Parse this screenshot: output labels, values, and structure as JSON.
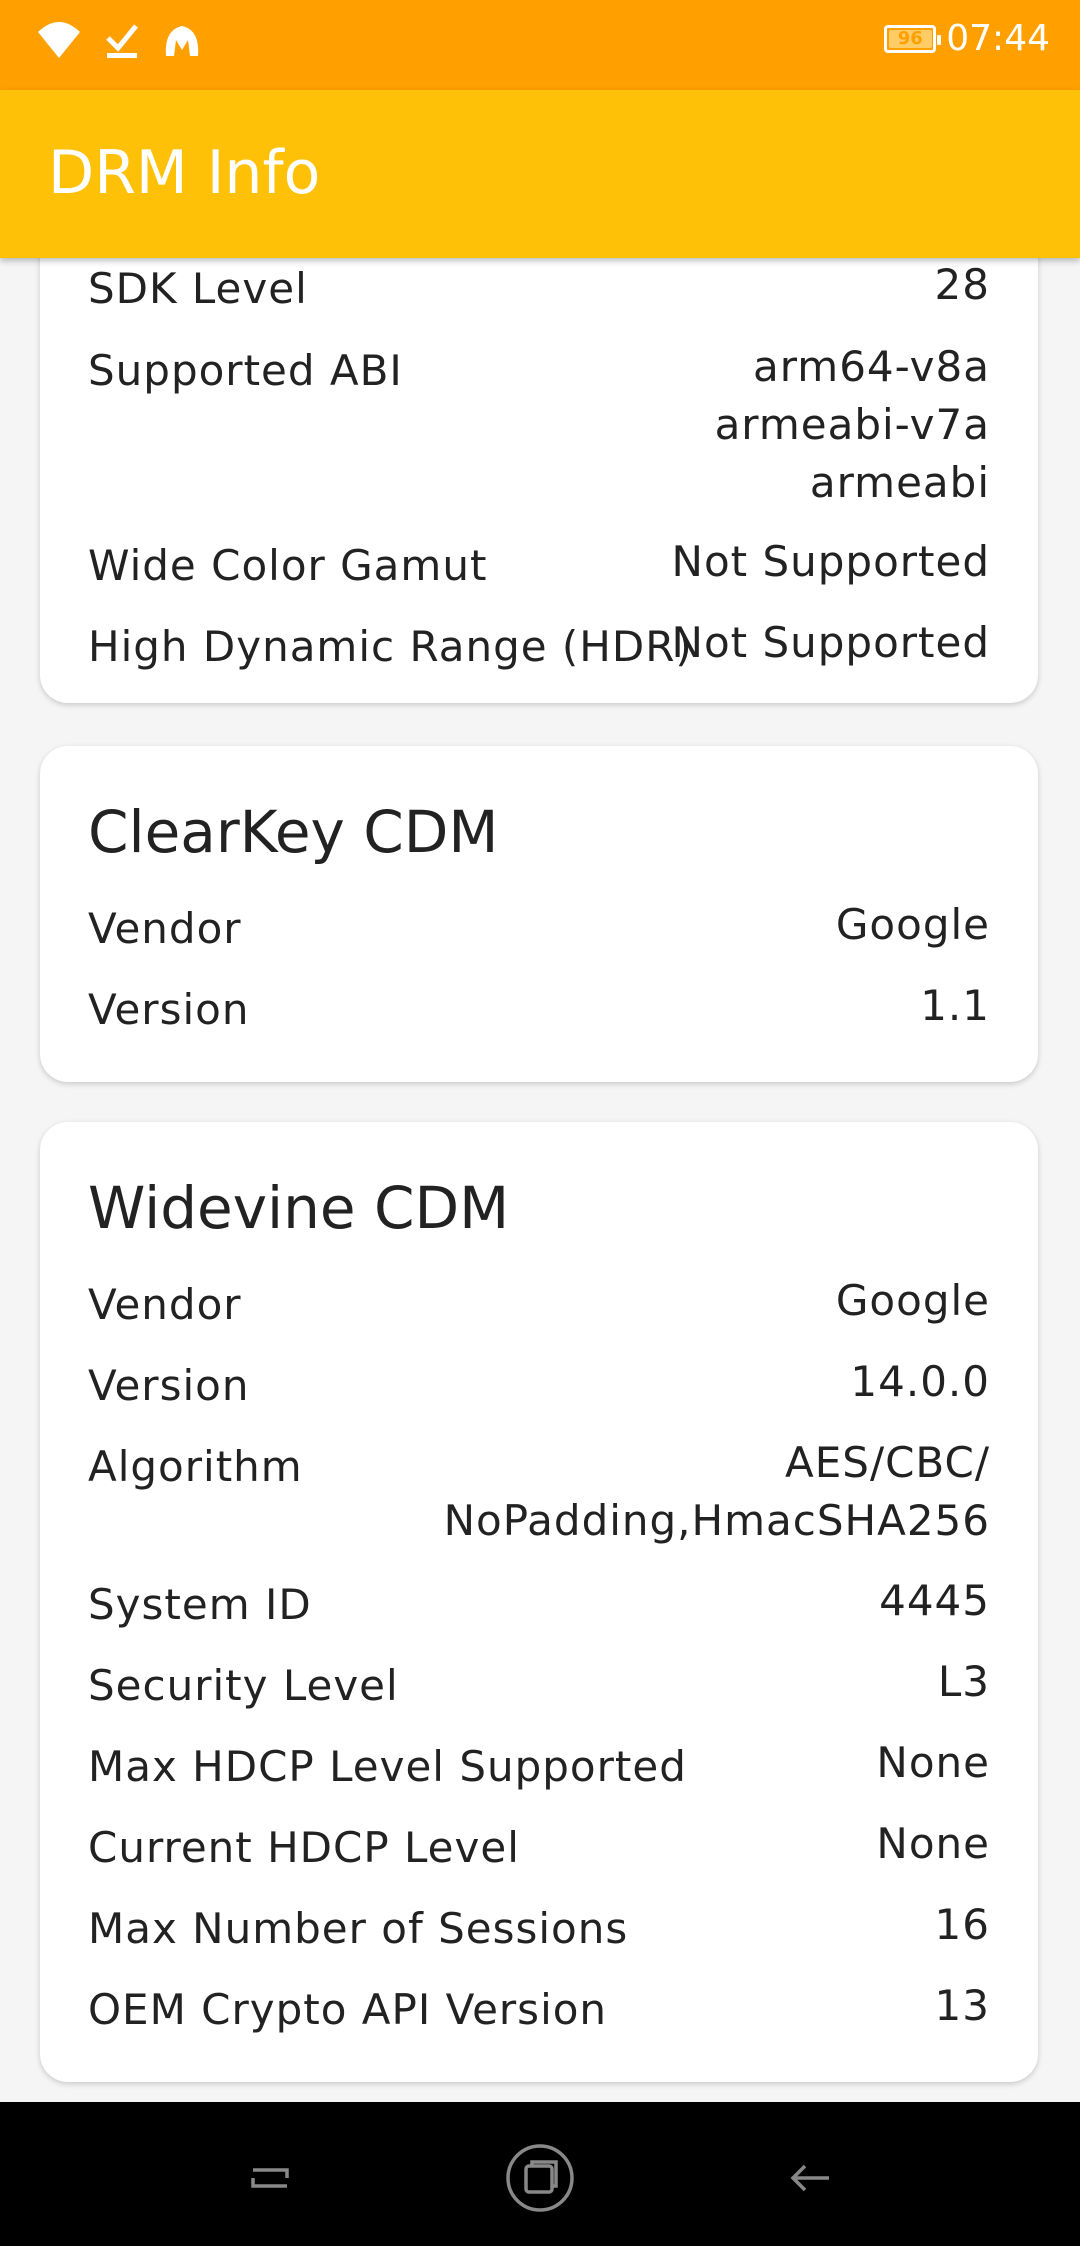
{
  "status_bar": {
    "time": "07:44",
    "battery_level": "96",
    "icons": [
      "wifi-icon",
      "download-done-icon",
      "malwarebytes-icon"
    ]
  },
  "app_bar": {
    "title": "DRM Info"
  },
  "system_card": {
    "rows": [
      {
        "label": "SDK Level",
        "value": "28"
      },
      {
        "label": "Supported ABI",
        "value": [
          "arm64-v8a",
          "armeabi-v7a",
          "armeabi"
        ]
      },
      {
        "label": "Wide Color Gamut",
        "value": "Not Supported"
      },
      {
        "label": "High Dynamic Range (HDR)",
        "value": "Not Supported"
      }
    ]
  },
  "clearkey_card": {
    "title": "ClearKey CDM",
    "rows": [
      {
        "label": "Vendor",
        "value": "Google"
      },
      {
        "label": "Version",
        "value": "1.1"
      }
    ]
  },
  "widevine_card": {
    "title": "Widevine CDM",
    "rows": [
      {
        "label": "Vendor",
        "value": "Google"
      },
      {
        "label": "Version",
        "value": "14.0.0"
      },
      {
        "label": "Algorithm",
        "value": [
          "AES/CBC/",
          "NoPadding,HmacSHA256"
        ]
      },
      {
        "label": "System ID",
        "value": "4445"
      },
      {
        "label": "Security Level",
        "value": "L3"
      },
      {
        "label": "Max HDCP Level Supported",
        "value": "None"
      },
      {
        "label": "Current HDCP Level",
        "value": "None"
      },
      {
        "label": "Max Number of Sessions",
        "value": "16"
      },
      {
        "label": "OEM Crypto API Version",
        "value": "13"
      }
    ]
  },
  "nav_bar": {
    "buttons": [
      "recents-icon",
      "home-icon",
      "back-icon"
    ]
  },
  "colors": {
    "status_bar": "#ffa000",
    "app_bar": "#ffc107",
    "background": "#f5f5f5",
    "card": "#ffffff"
  }
}
